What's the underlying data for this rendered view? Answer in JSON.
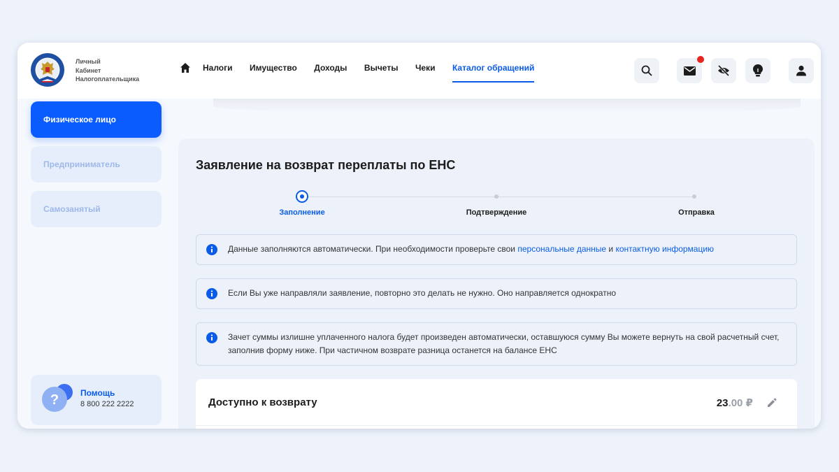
{
  "brand": {
    "line1": "Личный",
    "line2": "Кабинет",
    "line3": "Налогоплательщика"
  },
  "nav": {
    "items": [
      "Налоги",
      "Имущество",
      "Доходы",
      "Вычеты",
      "Чеки",
      "Каталог обращений"
    ],
    "active": "Каталог обращений"
  },
  "header_icons": [
    "search-icon",
    "mail-icon",
    "eye-off-icon",
    "lightbulb-icon",
    "user-icon"
  ],
  "sidebar": {
    "items": [
      {
        "label": "Физическое лицо",
        "active": true
      },
      {
        "label": "Предприниматель",
        "active": false
      },
      {
        "label": "Самозанятый",
        "active": false
      }
    ],
    "help": {
      "title": "Помощь",
      "phone": "8 800 222 2222"
    }
  },
  "main": {
    "title": "Заявление на возврат переплаты по ЕНС",
    "steps": [
      "Заполнение",
      "Подтверждение",
      "Отправка"
    ],
    "info1": {
      "text": "Данные заполняются автоматически. При необходимости проверьте свои ",
      "link1": "персональные данные",
      "mid": " и ",
      "link2": "контактную информацию"
    },
    "info2": "Если Вы уже направляли заявление, повторно это делать не нужно. Оно направляется однократно",
    "info3": "Зачет суммы излишне уплаченного налога будет произведен автоматически, оставшуюся сумму Вы можете вернуть на свой расчетный счет, заполнив форму ниже. При частичном возврате разница останется на балансе ЕНС",
    "refund": {
      "title": "Доступно к возврату",
      "amount_whole": "23",
      "amount_cents": ".00 ₽"
    }
  },
  "colors": {
    "accent": "#0a5ce8",
    "notification": "#e8241f"
  }
}
